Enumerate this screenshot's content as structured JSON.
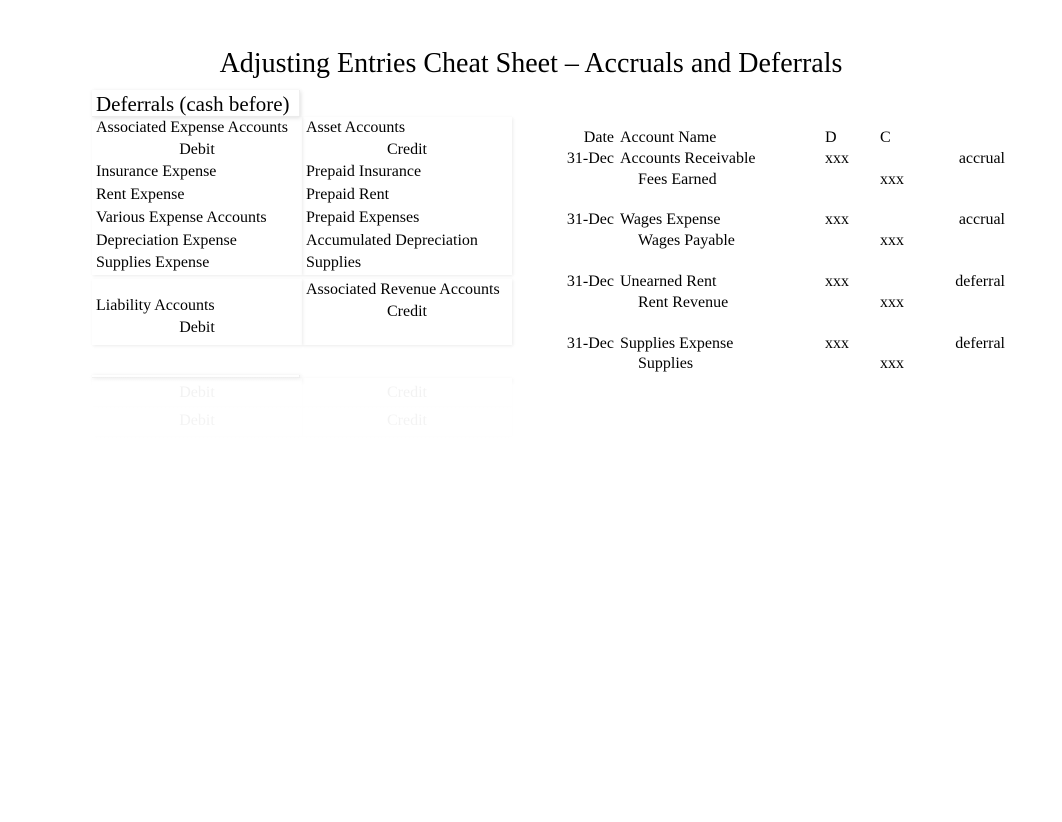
{
  "title": "Adjusting Entries Cheat Sheet – Accruals and Deferrals",
  "left": {
    "section1_title": "Deferrals (cash before)",
    "colA_head": "Associated Expense Accounts",
    "colB_head": "Asset Accounts",
    "debit_label": "Debit",
    "credit_label": "Credit",
    "pairs1": [
      {
        "a": "Insurance Expense",
        "b": "Prepaid Insurance"
      },
      {
        "a": "Rent Expense",
        "b": "Prepaid Rent"
      },
      {
        "a": "Various Expense Accounts",
        "b": "Prepaid Expenses"
      },
      {
        "a": "Depreciation Expense",
        "b": "Accumulated Depreciation"
      },
      {
        "a": "Supplies Expense",
        "b": "Supplies"
      }
    ],
    "colC_head": "Liability Accounts",
    "colD_head": "Associated Revenue Accounts",
    "pairs2": [
      {
        "a": "",
        "b": ""
      },
      {
        "a": "",
        "b": ""
      },
      {
        "a": "",
        "b": ""
      }
    ],
    "section2_title": "",
    "colE_head": "",
    "colF_head": "",
    "pairs3": [
      {
        "a": "",
        "b": ""
      }
    ],
    "colG_head": "",
    "colH_head": "",
    "pairs4": [
      {
        "a": "",
        "b": ""
      },
      {
        "a": "",
        "b": ""
      }
    ]
  },
  "journal": {
    "head_date": "Date",
    "head_acct": "Account Name",
    "head_d": "D",
    "head_c": "C",
    "entries": [
      {
        "date": "31-Dec",
        "debit_acct": "Accounts Receivable",
        "credit_acct": "Fees Earned",
        "d": "xxx",
        "c": "xxx",
        "type": "accrual"
      },
      {
        "date": "31-Dec",
        "debit_acct": "Wages Expense",
        "credit_acct": "Wages Payable",
        "d": "xxx",
        "c": "xxx",
        "type": "accrual"
      },
      {
        "date": "31-Dec",
        "debit_acct": "Unearned Rent",
        "credit_acct": "Rent Revenue",
        "d": "xxx",
        "c": "xxx",
        "type": "deferral"
      },
      {
        "date": "31-Dec",
        "debit_acct": "Supplies Expense",
        "credit_acct": "Supplies",
        "d": "xxx",
        "c": "xxx",
        "type": "deferral"
      },
      {
        "date": "",
        "debit_acct": "",
        "credit_acct": "",
        "d": "",
        "c": "",
        "type": ""
      },
      {
        "date": "",
        "debit_acct": "",
        "credit_acct": "",
        "d": "",
        "c": "",
        "type": ""
      },
      {
        "date": "",
        "debit_acct": "",
        "credit_acct": "",
        "d": "",
        "c": "",
        "type": ""
      },
      {
        "date": "",
        "debit_acct": "",
        "credit_acct": "",
        "d": "",
        "c": "",
        "type": ""
      },
      {
        "date": "",
        "debit_acct": "",
        "credit_acct": "",
        "d": "",
        "c": "",
        "type": ""
      }
    ]
  }
}
